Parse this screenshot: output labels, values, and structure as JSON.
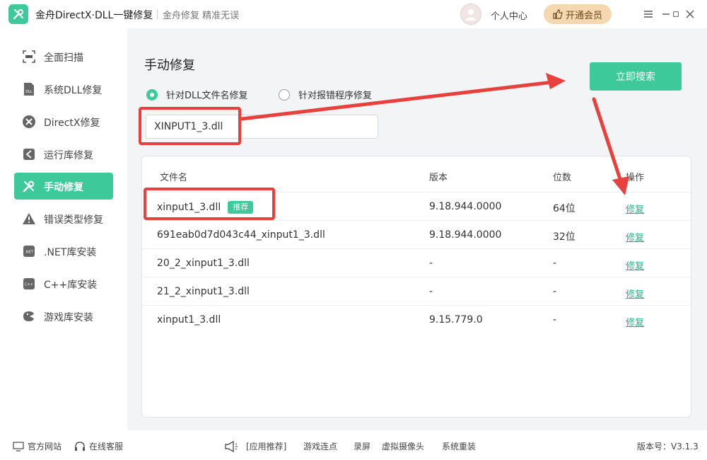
{
  "app": {
    "title": "金舟DirectX·DLL一键修复",
    "slogan": "金舟修复 精准无误",
    "user_center": "个人中心",
    "vip_label": "开通会员"
  },
  "sidebar": {
    "items": [
      {
        "label": "全面扫描",
        "icon": "scan-icon"
      },
      {
        "label": "系统DLL修复",
        "icon": "dll-icon"
      },
      {
        "label": "DirectX修复",
        "icon": "directx-icon"
      },
      {
        "label": "运行库修复",
        "icon": "runtime-icon"
      },
      {
        "label": "手动修复",
        "icon": "tools-icon"
      },
      {
        "label": "错误类型修复",
        "icon": "warning-icon"
      },
      {
        "label": ".NET库安装",
        "icon": "dotnet-icon"
      },
      {
        "label": "C++库安装",
        "icon": "cpp-icon"
      },
      {
        "label": "游戏库安装",
        "icon": "game-icon"
      }
    ]
  },
  "main": {
    "title": "手动修复",
    "radio_by_name": "针对DLL文件名修复",
    "radio_by_program": "针对报错程序修复",
    "search_value": "XINPUT1_3.dll",
    "search_button": "立即搜索",
    "table": {
      "headers": {
        "name": "文件名",
        "version": "版本",
        "bits": "位数",
        "action": "操作"
      },
      "recommend_badge": "推荐",
      "rows": [
        {
          "name": "xinput1_3.dll",
          "version": "9.18.944.0000",
          "bits": "64位",
          "action": "修复"
        },
        {
          "name": "691eab0d7d043c44_xinput1_3.dll",
          "version": "9.18.944.0000",
          "bits": "32位",
          "action": "修复"
        },
        {
          "name": "20_2_xinput1_3.dll",
          "version": "-",
          "bits": "-",
          "action": "修复"
        },
        {
          "name": "21_2_xinput1_3.dll",
          "version": "-",
          "bits": "-",
          "action": "修复"
        },
        {
          "name": "xinput1_3.dll",
          "version": "9.15.779.0",
          "bits": "-",
          "action": "修复"
        }
      ]
    }
  },
  "footer": {
    "website": "官方网站",
    "support": "在线客服",
    "recommend": "[应用推荐]",
    "links": [
      "游戏连点",
      "录屏",
      "虚拟摄像头",
      "系统重装"
    ],
    "version": "版本号：V3.1.3"
  },
  "colors": {
    "accent": "#3ec99a",
    "highlight": "#e8403c",
    "vip": "#f5d8b0"
  }
}
